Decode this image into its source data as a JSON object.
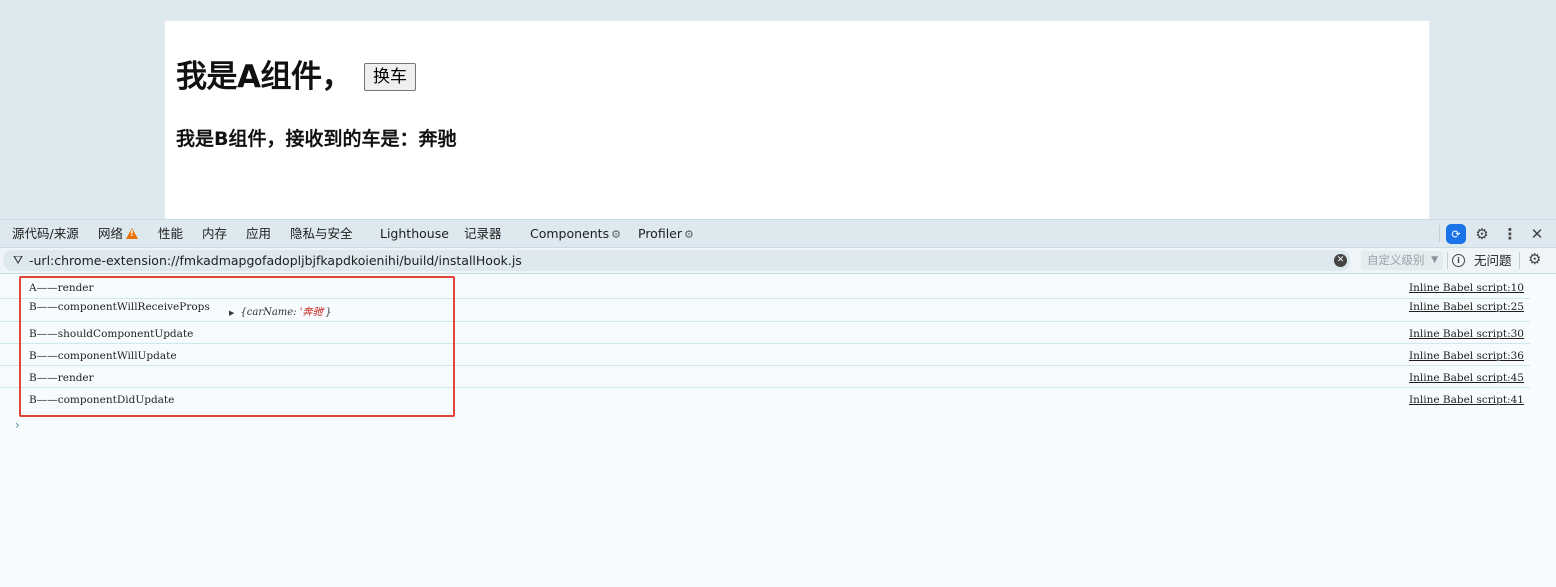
{
  "page": {
    "a_heading": "我是A组件，",
    "swap_button": "换车",
    "b_heading": "我是B组件，接收到的车是：奔驰"
  },
  "devtools": {
    "tabs": [
      {
        "label": "源代码/来源"
      },
      {
        "label": "网络",
        "icon": "warning-icon"
      },
      {
        "label": "性能"
      },
      {
        "label": "内存"
      },
      {
        "label": "应用"
      },
      {
        "label": "隐私与安全"
      },
      {
        "label": "Lighthouse"
      },
      {
        "label": "记录器"
      },
      {
        "label": "Components",
        "icon": "gear-icon"
      },
      {
        "label": "Profiler",
        "icon": "gear-icon"
      }
    ],
    "toolbar_icons": [
      "extension-icon",
      "settings-icon",
      "more-vert-icon",
      "close-icon"
    ],
    "filter": {
      "value": "-url:chrome-extension://fmkadmapgofadopljbjfkapdkoienihi/build/installHook.js",
      "level_label": "自定义级别",
      "issues_label": "无问题"
    },
    "console": {
      "rows": [
        {
          "message": "A——render",
          "source": "Inline Babel script:10"
        },
        {
          "message": "B——componentWillReceiveProps",
          "source": "Inline Babel script:25",
          "object": {
            "prefix": "{carName: ",
            "value": "'奔驰'",
            "suffix": "}"
          }
        },
        {
          "message": "B——shouldComponentUpdate",
          "source": "Inline Babel script:30"
        },
        {
          "message": "B——componentWillUpdate",
          "source": "Inline Babel script:36"
        },
        {
          "message": "B——render",
          "source": "Inline Babel script:45"
        },
        {
          "message": "B——componentDidUpdate",
          "source": "Inline Babel script:41"
        }
      ],
      "prompt": "›"
    },
    "colors": {
      "highlight": "#e0463c",
      "accent": "#1a73e8",
      "warning": "#e8710a"
    }
  }
}
